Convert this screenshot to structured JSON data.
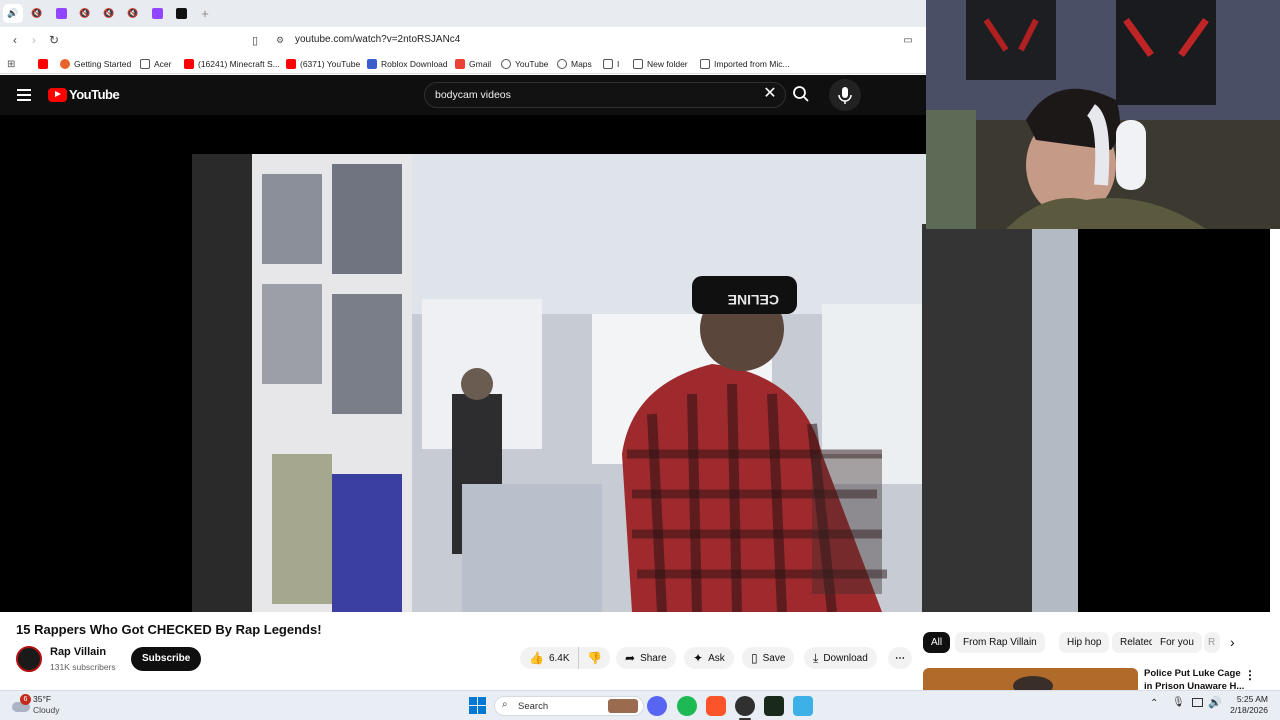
{
  "browser": {
    "url": "youtube.com/watch?v=2ntoRSJANc4",
    "bookmarks": [
      "Getting Started",
      "Acer",
      "(16241) Minecraft S...",
      "(6371) YouTube",
      "Roblox Download",
      "Gmail",
      "YouTube",
      "Maps",
      "I",
      "New folder",
      "Imported from Mic..."
    ]
  },
  "youtube": {
    "logo_text": "YouTube",
    "search_value": "bodycam videos",
    "video_title": "15 Rappers Who Got CHECKED By Rap Legends!",
    "channel_name": "Rap Villain",
    "subscribers": "131K subscribers",
    "subscribe_label": "Subscribe",
    "likes": "6.4K",
    "share_label": "Share",
    "ask_label": "Ask",
    "save_label": "Save",
    "download_label": "Download",
    "chips": [
      "All",
      "From Rap Villain",
      "Hip hop",
      "Related",
      "For you",
      "R"
    ],
    "rec_title_1": "Police Put Luke Cage",
    "rec_title_2": "in Prison Unaware H..."
  },
  "video_overlay_text": "CELINE",
  "taskbar": {
    "weather_badge": "6",
    "temp": "35°F",
    "condition": "Cloudy",
    "search_label": "Search",
    "time": "5:25 AM",
    "date": "2/18/2026"
  },
  "colors": {
    "youtube_red": "#ff0000",
    "dark_bg": "#0f0f0f",
    "chip_active": "#0f0f0f"
  }
}
